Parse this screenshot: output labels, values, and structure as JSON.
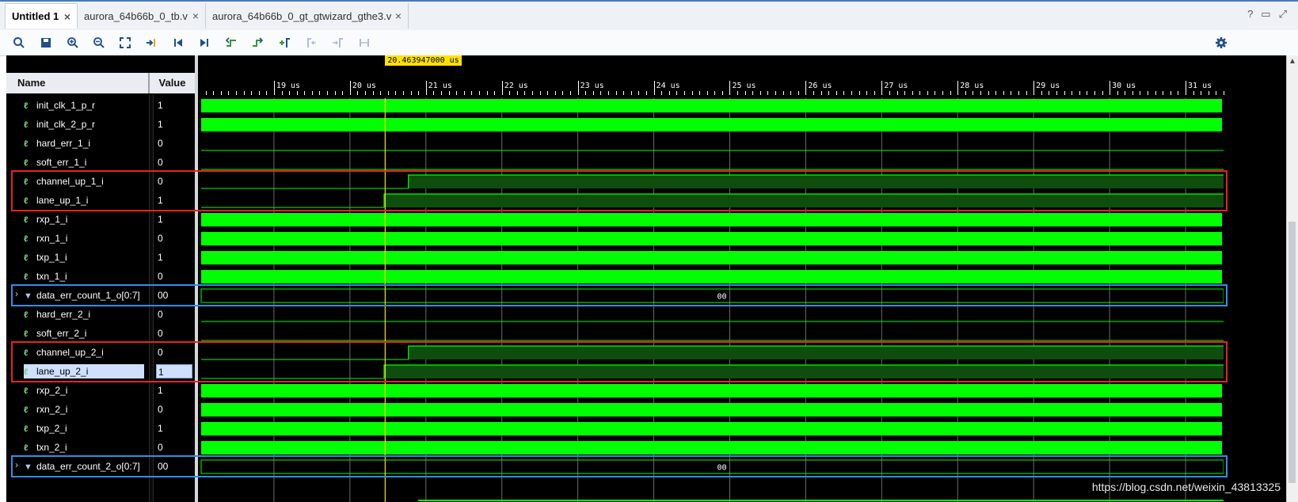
{
  "tabs": [
    {
      "label": "Untitled 1",
      "active": true
    },
    {
      "label": "aurora_64b66b_0_tb.v",
      "active": false
    },
    {
      "label": "aurora_64b66b_0_gt_gtwizard_gthe3.v",
      "active": false
    }
  ],
  "window_controls": [
    "?",
    "restore",
    "maximize"
  ],
  "toolbar": {
    "icons": [
      "search-icon",
      "save-icon",
      "zoom-in-icon",
      "zoom-out-icon",
      "zoom-fit-icon",
      "goto-cursor-icon",
      "goto-start-icon",
      "goto-end-icon",
      "previous-transition-icon",
      "next-transition-icon",
      "add-marker-icon",
      "previous-marker-icon",
      "next-marker-icon",
      "swap-cursors-icon"
    ],
    "settings_icon": "gear-icon"
  },
  "columns": {
    "name": "Name",
    "value": "Value"
  },
  "cursor": {
    "time_label": "20.463947000 us",
    "time_us": 20.463947
  },
  "colors": {
    "waveform": "#00ff00",
    "cursor": "#ffe200",
    "highlight_red": "#e8231f",
    "highlight_blue": "#2f8fe8"
  },
  "timeline": {
    "start_us": 18.0,
    "end_us": 31.5,
    "ticks": [
      {
        "label": "19 us",
        "t": 19
      },
      {
        "label": "20 us",
        "t": 20
      },
      {
        "label": "21 us",
        "t": 21
      },
      {
        "label": "22 us",
        "t": 22
      },
      {
        "label": "23 us",
        "t": 23
      },
      {
        "label": "24 us",
        "t": 24
      },
      {
        "label": "25 us",
        "t": 25
      },
      {
        "label": "26 us",
        "t": 26
      },
      {
        "label": "27 us",
        "t": 27
      },
      {
        "label": "28 us",
        "t": 28
      },
      {
        "label": "29 us",
        "t": 29
      },
      {
        "label": "30 us",
        "t": 30
      },
      {
        "label": "31 us",
        "t": 31
      }
    ]
  },
  "signals": [
    {
      "name": "init_clk_1_p_r",
      "value": "1",
      "kind": "clock"
    },
    {
      "name": "init_clk_2_p_r",
      "value": "1",
      "kind": "clock"
    },
    {
      "name": "hard_err_1_i",
      "value": "0",
      "kind": "low"
    },
    {
      "name": "soft_err_1_i",
      "value": "0",
      "kind": "low"
    },
    {
      "name": "channel_up_1_i",
      "value": "0",
      "kind": "rise",
      "rise_us": 20.77
    },
    {
      "name": "lane_up_1_i",
      "value": "1",
      "kind": "rise",
      "rise_us": 20.45
    },
    {
      "name": "rxp_1_i",
      "value": "1",
      "kind": "clock"
    },
    {
      "name": "rxn_1_i",
      "value": "0",
      "kind": "clock"
    },
    {
      "name": "txp_1_i",
      "value": "1",
      "kind": "clock"
    },
    {
      "name": "txn_1_i",
      "value": "0",
      "kind": "clock"
    },
    {
      "name": "data_err_count_1_o[0:7]",
      "value": "00",
      "kind": "bus",
      "bus_text": "00"
    },
    {
      "name": "hard_err_2_i",
      "value": "0",
      "kind": "low"
    },
    {
      "name": "soft_err_2_i",
      "value": "0",
      "kind": "low"
    },
    {
      "name": "channel_up_2_i",
      "value": "0",
      "kind": "rise",
      "rise_us": 20.77
    },
    {
      "name": "lane_up_2_i",
      "value": "1",
      "kind": "rise",
      "rise_us": 20.45,
      "selected": true
    },
    {
      "name": "rxp_2_i",
      "value": "1",
      "kind": "clock"
    },
    {
      "name": "rxn_2_i",
      "value": "0",
      "kind": "clock"
    },
    {
      "name": "txp_2_i",
      "value": "1",
      "kind": "clock"
    },
    {
      "name": "txn_2_i",
      "value": "0",
      "kind": "clock"
    },
    {
      "name": "data_err_count_2_o[0:7]",
      "value": "00",
      "kind": "bus",
      "bus_text": "00"
    }
  ],
  "watermark": "https://blog.csdn.net/weixin_43813325"
}
